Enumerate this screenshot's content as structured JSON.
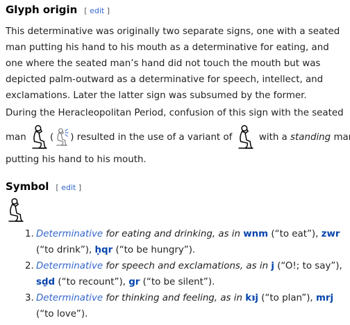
{
  "glyph_origin": {
    "title": "Glyph origin",
    "edit_label": "edit",
    "p1": "This determinative was originally two separate signs, one with a seated man putting his hand to his mouth as a determinative for eating, and one where the seated man’s hand did not touch the mouth but was depicted palm-outward as a determinative for speech, intellect, and exclamations. Later the latter sign was subsumed by the former.",
    "p2": "During the Heracleopolitan Period, confusion of this sign with the seated",
    "p3": {
      "man": "man",
      "open_paren": "(",
      "mid": ") resulted in the use of a variant of",
      "with_a": "with a",
      "standing": "standing",
      "man_end": "man"
    },
    "p4": "putting his hand to his mouth."
  },
  "symbol": {
    "title": "Symbol",
    "edit_label": "edit",
    "items": [
      {
        "num": "1.",
        "det": "Determinative",
        "desc": "for eating and drinking, as in",
        "w1": "wnm",
        "g1": "(“to eat”),",
        "w2": "zwr",
        "g2": "(“to drink”),",
        "w3": "ḥqr",
        "g3": "(“to be hungry”)."
      },
      {
        "num": "2.",
        "det": "Determinative",
        "desc": "for speech and exclamations, as in",
        "w1": "j",
        "g1": "(“O!; to say”),",
        "w2": "sḏd",
        "g2": "(“to recount”),",
        "w3": "gr",
        "g3": "(“to be silent”)."
      },
      {
        "num": "3.",
        "det": "Determinative",
        "desc": "for thinking and feeling, as in",
        "w1": "kꜣj",
        "g1": "(“to plan”),",
        "w2": "mrj",
        "g2": "(“to love”)."
      }
    ]
  }
}
